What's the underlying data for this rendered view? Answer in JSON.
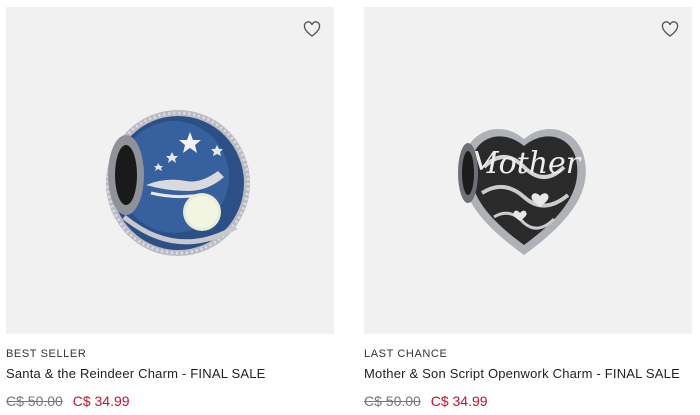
{
  "products": [
    {
      "badge": "BEST SELLER",
      "title": "Santa & the Reindeer Charm - FINAL SALE",
      "original_price": "C$ 50.00",
      "sale_price": "C$ 34.99",
      "wishlist_icon": "heart-outline-icon"
    },
    {
      "badge": "LAST CHANCE",
      "title": "Mother & Son Script Openwork Charm - FINAL SALE",
      "original_price": "C$ 50.00",
      "sale_price": "C$ 34.99",
      "wishlist_icon": "heart-outline-icon"
    }
  ],
  "colors": {
    "image_background": "#f1f1f1",
    "sale_price": "#c8102e",
    "original_price": "#777777",
    "enamel_blue": "#2c4f86"
  }
}
